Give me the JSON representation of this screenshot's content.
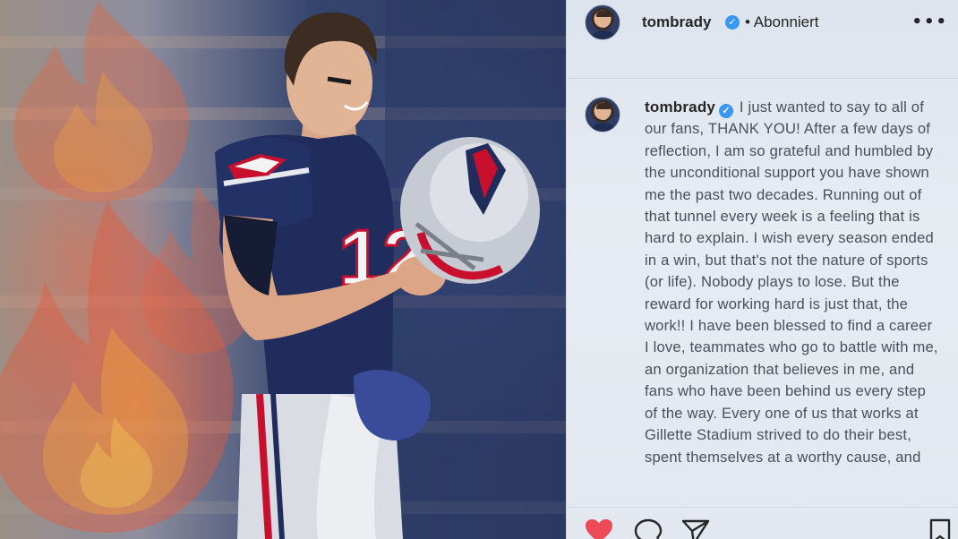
{
  "post": {
    "username": "tombrady",
    "follow_state": "• Abonniert",
    "more_label": "•••",
    "verified_badge": "✓",
    "caption": "I just wanted to say to all of our fans, THANK YOU! After a few days of reflection, I am so grateful and humbled by the unconditional support you have shown me the past two decades. Running out of that tunnel every week is a feeling that is hard to explain. I wish every season ended in a win, but that's not the nature of sports (or life). Nobody plays to lose. But the reward for working hard is just that, the work!! I have been blessed to find a career I love, teammates who go to battle with me, an organization that believes in me, and fans who have been behind us every step of the way. Every one of us that works at Gillette Stadium strived to do their best, spent themselves at a worthy cause, and"
  },
  "actions": {
    "like_icon": "heart-icon",
    "comment_icon": "comment-icon",
    "share_icon": "share-icon",
    "save_icon": "bookmark-icon",
    "like_color": "#ed4956"
  },
  "photo": {
    "subject": "football-player-photo",
    "jersey_number": "12"
  }
}
